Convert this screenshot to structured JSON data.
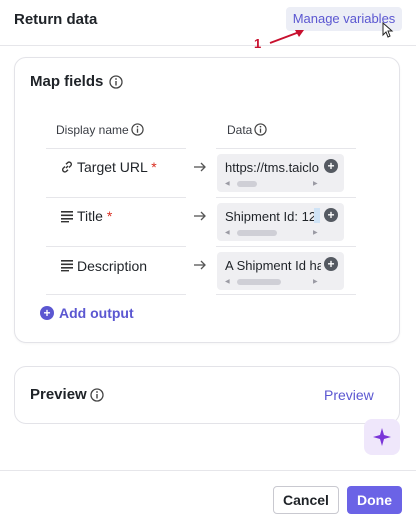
{
  "header": {
    "title": "Return data",
    "manage_variables_label": "Manage variables",
    "annotation_number": "1"
  },
  "map_fields": {
    "title": "Map fields",
    "columns": {
      "display_name": "Display name",
      "data": "Data"
    },
    "rows": [
      {
        "label": "Target URL",
        "required": "*",
        "icon": "link-icon",
        "value": "https://tms.taiclo"
      },
      {
        "label": "Title",
        "required": "*",
        "icon": "text-lines-icon",
        "value": "Shipment Id: 12"
      },
      {
        "label": "Description",
        "required": "",
        "icon": "text-lines-icon",
        "value": "A Shipment Id ha"
      }
    ],
    "add_output_label": "Add output"
  },
  "preview": {
    "title": "Preview",
    "link_label": "Preview"
  },
  "footer": {
    "cancel_label": "Cancel",
    "done_label": "Done"
  },
  "colors": {
    "accent": "#5b57d1",
    "primary_button": "#6b63e6",
    "required": "#d92d20",
    "annotation": "#c8102e",
    "sparkle": "#7a35d8"
  },
  "icons": [
    "info-icon",
    "link-icon",
    "text-lines-icon",
    "arrow-right-icon",
    "plus-icon",
    "sparkle-icon",
    "cursor-icon"
  ]
}
